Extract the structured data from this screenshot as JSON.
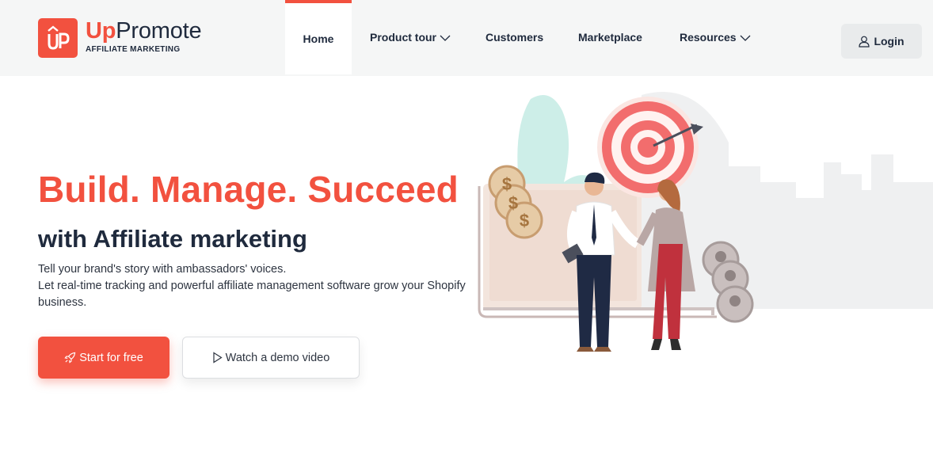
{
  "brand": {
    "logo_mark": "ÛP",
    "name_prefix": "Up",
    "name_rest": "Promote",
    "tagline": "AFFILIATE MARKETING"
  },
  "nav": {
    "items": [
      {
        "label": "Home",
        "active": true
      },
      {
        "label": "Product tour",
        "has_dropdown": true
      },
      {
        "label": "Customers"
      },
      {
        "label": "Marketplace"
      },
      {
        "label": "Resources",
        "has_dropdown": true
      }
    ],
    "login_label": "Login"
  },
  "hero": {
    "title": "Build. Manage. Succeed",
    "subtitle": "with Affiliate marketing",
    "desc_line1": "Tell your brand's story with ambassadors' voices.",
    "desc_line2": "Let real-time tracking and powerful affiliate management software grow your Shopify business.",
    "cta_primary": "Start for free",
    "cta_secondary": "Watch a demo video"
  },
  "colors": {
    "accent": "#f2513f",
    "text_dark": "#1f2a3d",
    "header_bg": "#f5f6f6"
  },
  "icons": {
    "login": "user-icon",
    "cta_primary": "rocket-icon",
    "cta_secondary": "play-icon",
    "dropdown": "chevron-down-icon"
  }
}
